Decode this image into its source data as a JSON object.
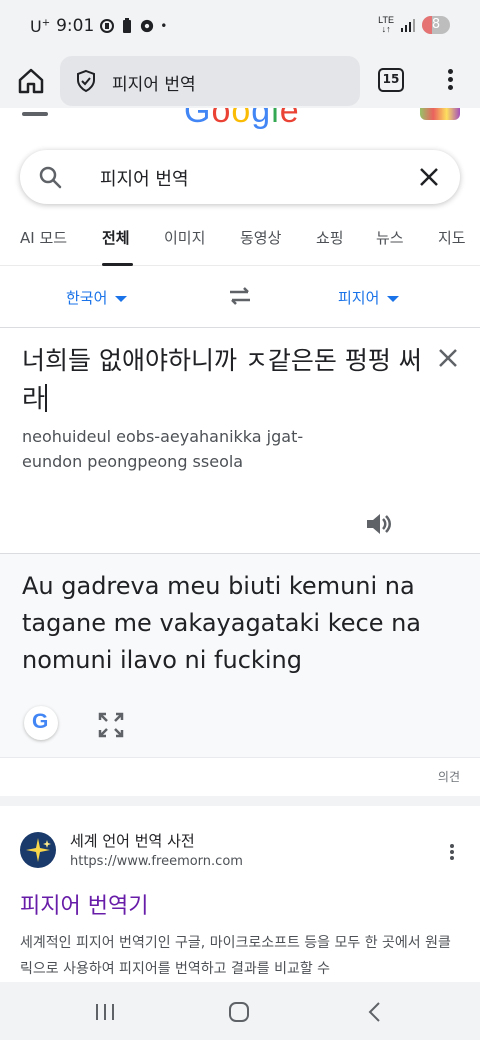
{
  "status_bar": {
    "carrier": "U",
    "carrier_sup": "+",
    "time": "9:01",
    "network": "LTE",
    "battery": "8",
    "extra_dot": "•"
  },
  "browser": {
    "url_text": "피지어 번역",
    "tab_count": "15"
  },
  "google_header": {
    "logo": "Google"
  },
  "search": {
    "query": "피지어 번역"
  },
  "tabs": [
    {
      "label": "AI 모드"
    },
    {
      "label": "전체"
    },
    {
      "label": "이미지"
    },
    {
      "label": "동영상"
    },
    {
      "label": "쇼핑"
    },
    {
      "label": "뉴스"
    },
    {
      "label": "지도"
    }
  ],
  "translator": {
    "source_lang": "한국어",
    "target_lang": "피지어",
    "source_text": "너희들 없애야하니까 ㅈ같은돈 펑펑 써라",
    "romanization": "neohuideul eobs-aeyahanikka jgat-eundon peongpeong sseola",
    "result_text": "Au gadreva meu biuti kemuni na tagane me vakayagataki kece na nomuni ilavo ni fucking",
    "feedback": "의견"
  },
  "result": {
    "site_name": "세계 언어 번역 사전",
    "site_url": "https://www.freemorn.com",
    "title": "피지어 번역기",
    "snippet": "세계적인 피지어 번역기인 구글, 마이크로소프트 등을 모두 한 곳에서 원클릭으로 사용하여 피지어를 번역하고 결과를 비교할 수"
  },
  "colors": {
    "link_blue": "#1a73e8",
    "visited_purple": "#681da8",
    "chrome_bg": "#f1f3f4"
  }
}
